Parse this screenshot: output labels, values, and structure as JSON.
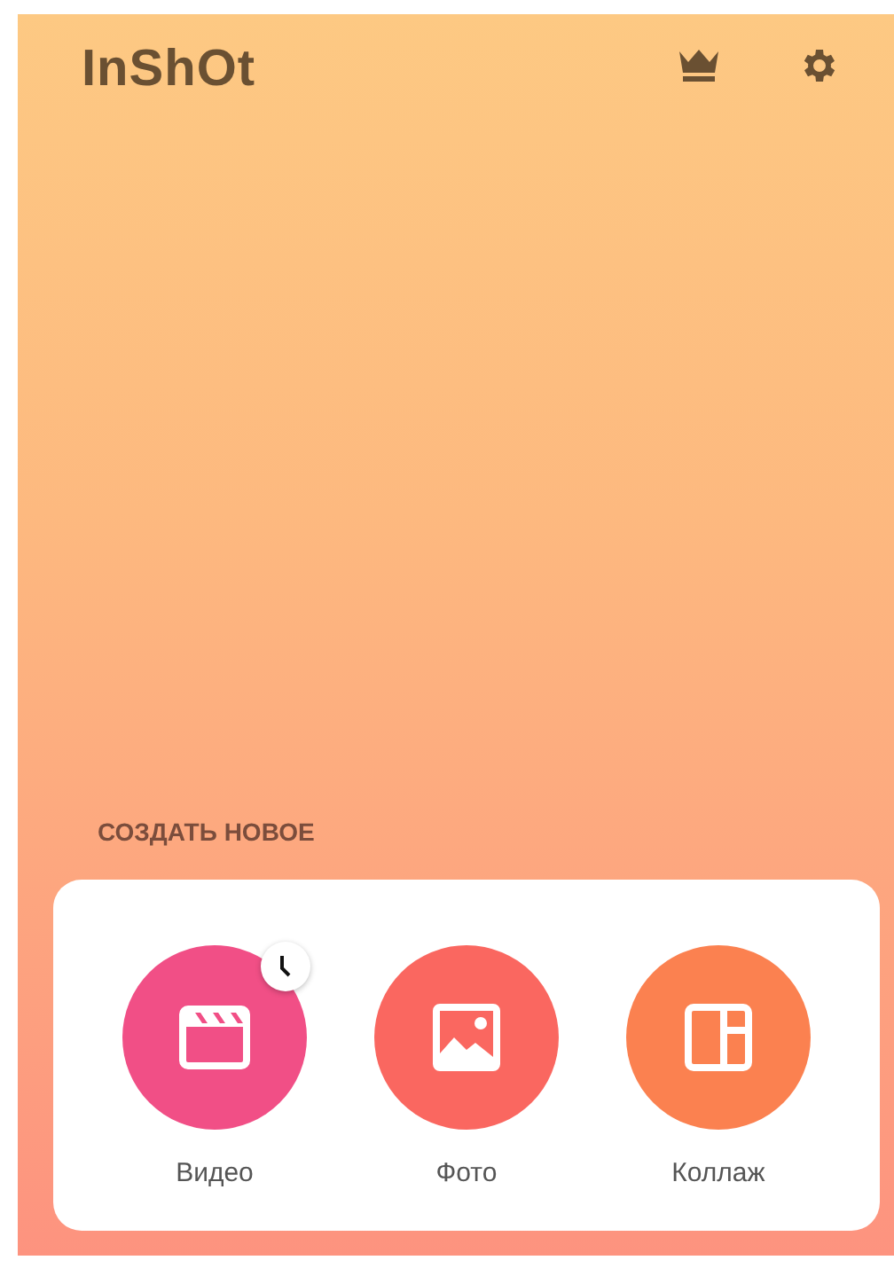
{
  "app": {
    "logo": "InShOt"
  },
  "section_title": "СОЗДАТЬ НОВОЕ",
  "create_items": [
    {
      "kind": "video",
      "label": "Видео",
      "color": "#f14f86",
      "clock_badge": true
    },
    {
      "kind": "photo",
      "label": "Фото",
      "color": "#fa6760",
      "clock_badge": false
    },
    {
      "kind": "collage",
      "label": "Коллаж",
      "color": "#fb8150",
      "clock_badge": false
    }
  ]
}
